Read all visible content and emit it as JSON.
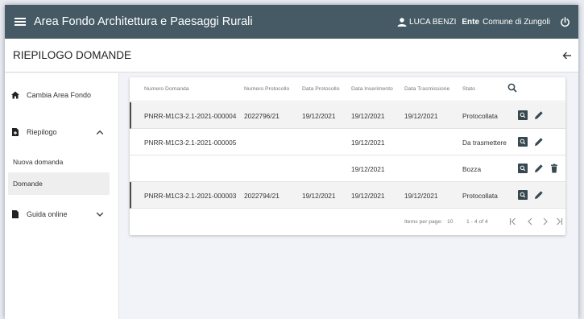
{
  "app": {
    "title": "Area Fondo Architettura e Paesaggi Rurali",
    "user": "LUCA BENZI",
    "ente_label": "Ente",
    "ente_value": "Comune di Zungoli",
    "icons": {
      "menu": "menu-icon",
      "user": "user-icon",
      "power": "power-icon"
    }
  },
  "page": {
    "title": "RIEPILOGO DOMANDE",
    "back_icon": "arrow-left-icon"
  },
  "sidebar": {
    "items": [
      {
        "label": "Cambia Area Fondo",
        "icon": "home-icon"
      },
      {
        "label": "Riepilogo",
        "icon": "file-plus-icon",
        "expanded": true,
        "children": [
          {
            "label": "Nuova domanda"
          },
          {
            "label": "Domande",
            "active": true
          }
        ]
      },
      {
        "label": "Guida online",
        "icon": "document-icon",
        "expanded": false
      }
    ]
  },
  "table": {
    "columns": [
      "Numero Domanda",
      "Numero Protocollo",
      "Data Protocollo",
      "Data Inserimento",
      "Data Trasmissione",
      "Stato"
    ],
    "rows": [
      {
        "numero_domanda": "PNRR-M1C3-2.1-2021-000004",
        "numero_protocollo": "2022796/21",
        "data_protocollo": "19/12/2021",
        "data_inserimento": "19/12/2021",
        "data_trasmissione": "19/12/2021",
        "stato": "Protocollata"
      },
      {
        "numero_domanda": "PNRR-M1C3-2.1-2021-000005",
        "numero_protocollo": "",
        "data_protocollo": "",
        "data_inserimento": "19/12/2021",
        "data_trasmissione": "",
        "stato": "Da trasmettere"
      },
      {
        "numero_domanda": "",
        "numero_protocollo": "",
        "data_protocollo": "",
        "data_inserimento": "19/12/2021",
        "data_trasmissione": "",
        "stato": "Bozza"
      },
      {
        "numero_domanda": "PNRR-M1C3-2.1-2021-000003",
        "numero_protocollo": "2022794/21",
        "data_protocollo": "19/12/2021",
        "data_inserimento": "19/12/2021",
        "data_trasmissione": "19/12/2021",
        "stato": "Protocollata"
      }
    ]
  },
  "paginator": {
    "items_per_page_label": "Items per page:",
    "page_size": "10",
    "range": "1 - 4 of 4"
  },
  "colors": {
    "topbar": "#455a64",
    "icon_dark": "#37474f"
  }
}
